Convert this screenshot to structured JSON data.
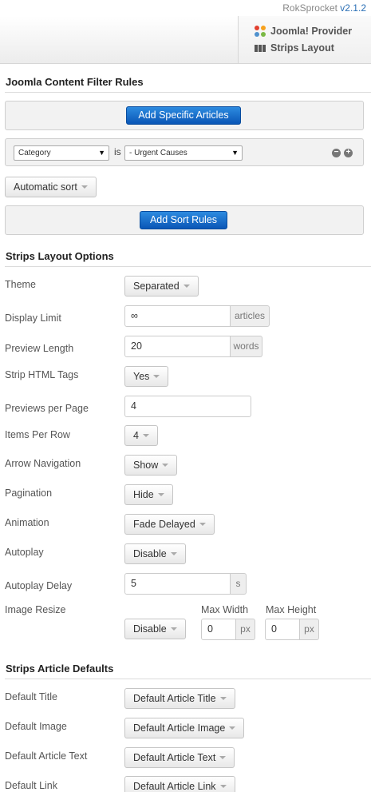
{
  "header": {
    "brand": "RokSprocket",
    "version": "v2.1.2",
    "provider_label": "Joomla! Provider",
    "layout_label": "Strips Layout",
    "provider_icon": "joomla-icon",
    "layout_icon": "strips-icon"
  },
  "filter": {
    "title": "Joomla Content Filter Rules",
    "add_articles_label": "Add Specific Articles",
    "rule": {
      "field": "Category",
      "operator": "is",
      "value": "- Urgent Causes"
    },
    "sort_label": "Automatic sort",
    "add_sort_label": "Add Sort Rules"
  },
  "options": {
    "title": "Strips Layout Options",
    "theme": {
      "label": "Theme",
      "value": "Separated"
    },
    "display_limit": {
      "label": "Display Limit",
      "value": "∞",
      "unit": "articles"
    },
    "preview_length": {
      "label": "Preview Length",
      "value": "20",
      "unit": "words"
    },
    "strip_html": {
      "label": "Strip HTML Tags",
      "value": "Yes"
    },
    "previews_per_page": {
      "label": "Previews per Page",
      "value": "4"
    },
    "items_per_row": {
      "label": "Items Per Row",
      "value": "4"
    },
    "arrow_navigation": {
      "label": "Arrow Navigation",
      "value": "Show"
    },
    "pagination": {
      "label": "Pagination",
      "value": "Hide"
    },
    "animation": {
      "label": "Animation",
      "value": "Fade Delayed"
    },
    "autoplay": {
      "label": "Autoplay",
      "value": "Disable"
    },
    "autoplay_delay": {
      "label": "Autoplay Delay",
      "value": "5",
      "unit": "s"
    },
    "image_resize": {
      "label": "Image Resize",
      "value": "Disable",
      "max_width_label": "Max Width",
      "max_width": "0",
      "max_height_label": "Max Height",
      "max_height": "0",
      "unit": "px"
    }
  },
  "defaults": {
    "title": "Strips Article Defaults",
    "default_title": {
      "label": "Default Title",
      "value": "Default Article Title"
    },
    "default_image": {
      "label": "Default Image",
      "value": "Default Article Image"
    },
    "default_text": {
      "label": "Default Article Text",
      "value": "Default Article Text"
    },
    "default_link": {
      "label": "Default Link",
      "value": "Default Article Link"
    }
  },
  "colors": {
    "accent": "#0a56b6",
    "version": "#2a6fb5"
  }
}
